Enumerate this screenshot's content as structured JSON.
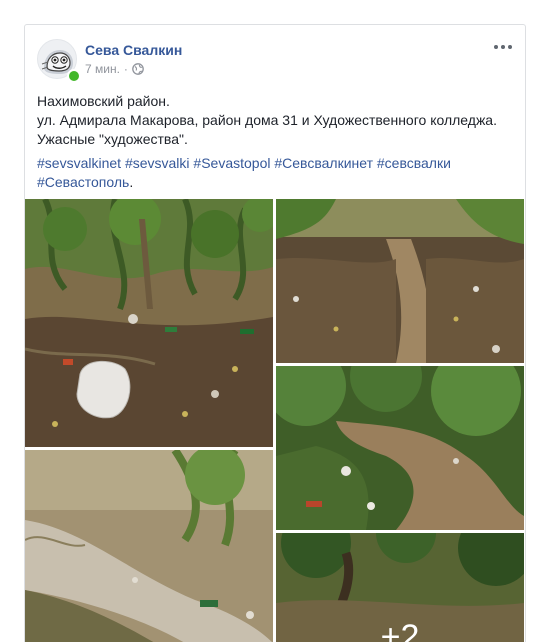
{
  "post": {
    "author": "Сева Свалкин",
    "time": "7 мин.",
    "separator": "·",
    "privacy_icon": "globe-icon",
    "text_lines": [
      "Нахимовский район.",
      "ул. Адмирала Макарова, район дома 31 и Художественного колледжа.",
      "Ужасные \"художества\"."
    ],
    "hashtags": [
      "#sevsvalkinet",
      "#sevsvalki",
      "#Sevastopol",
      "#Севсвалкинет",
      "#севсвалки",
      "#Севастополь"
    ],
    "tags_end": ".",
    "more_photos": "+2"
  },
  "colors": {
    "link": "#365899",
    "meta": "#90949c",
    "online": "#42b72a"
  }
}
